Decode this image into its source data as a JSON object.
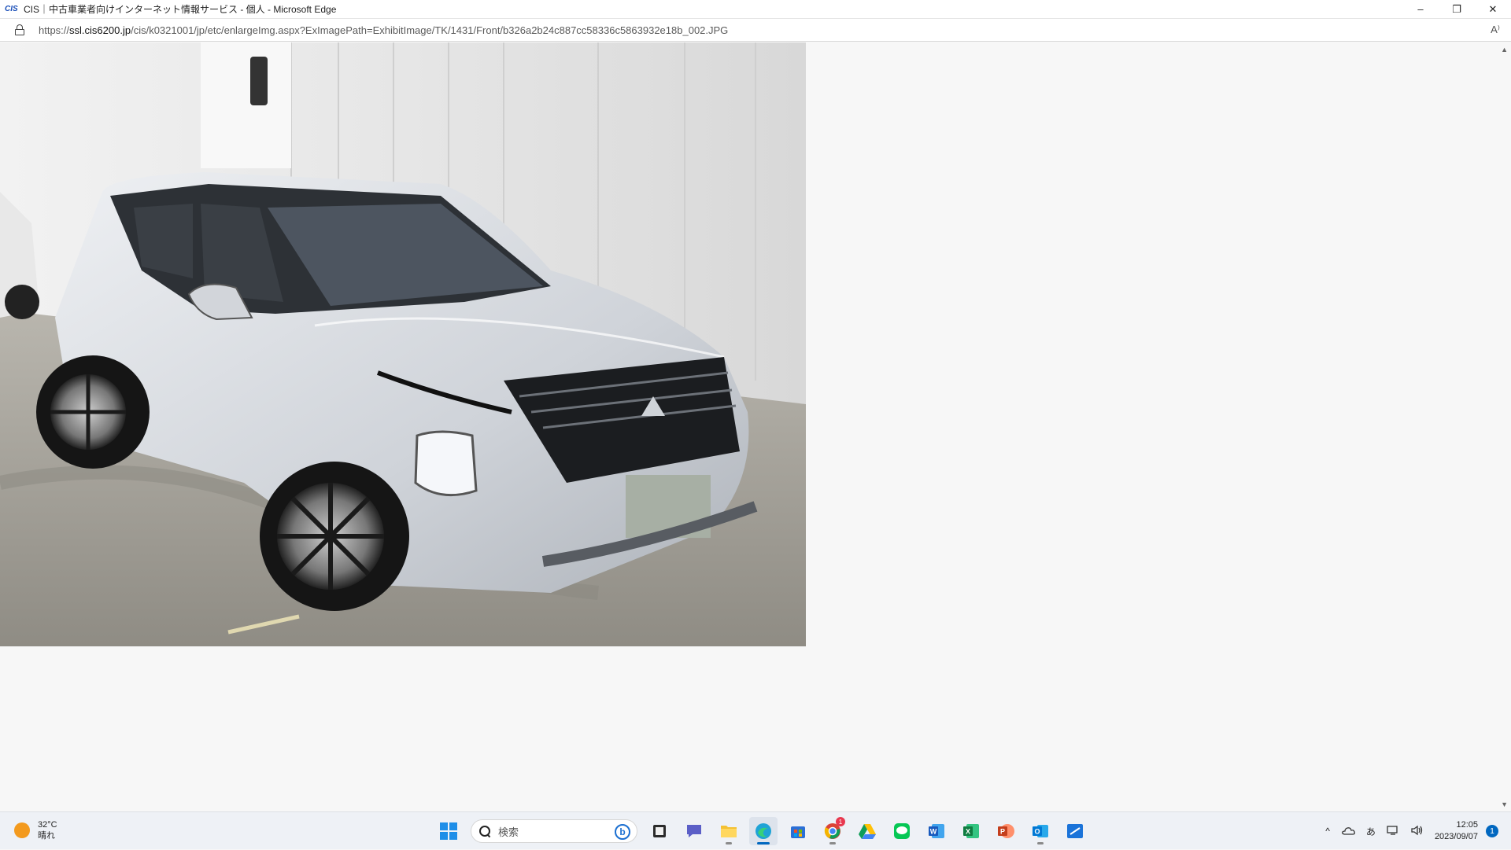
{
  "window": {
    "app_icon_text": "CIS",
    "title": "CIS｜中古車業者向けインターネット情報サービス - 個人 - Microsoft Edge",
    "minimize": "–",
    "restore": "❐",
    "close": "✕"
  },
  "address": {
    "url_scheme": "https://",
    "url_host": "ssl.cis6200.jp",
    "url_path": "/cis/k0321001/jp/etc/enlargeImg.aspx?ExImagePath=ExhibitImage/TK/1431/Front/b326a2b24c887cc58336c5863932e18b_002.JPG",
    "read_aloud": "A⁾"
  },
  "content": {
    "image": "silver-suv-front-photo",
    "scroll_up": "▲",
    "scroll_down": "▼"
  },
  "taskbar": {
    "weather": {
      "temp": "32°C",
      "condition": "晴れ"
    },
    "search_placeholder": "検索",
    "apps": [
      "windows-start-icon",
      "file-manager-icon",
      "teams-chat-icon",
      "file-explorer-icon",
      "edge-icon",
      "store-icon",
      "chrome-icon",
      "google-drive-icon",
      "line-icon",
      "word-icon",
      "excel-icon",
      "powerpoint-icon",
      "outlook-icon",
      "snipping-icon"
    ],
    "chrome_badge": "1",
    "tray": {
      "chevron": "^",
      "ime": "あ"
    },
    "clock": {
      "time": "12:05",
      "date": "2023/09/07"
    },
    "notifications": "1"
  },
  "colors": {
    "accent": "#0067c0",
    "car_body": "#d6d9de",
    "plate": "#a7afa4"
  }
}
